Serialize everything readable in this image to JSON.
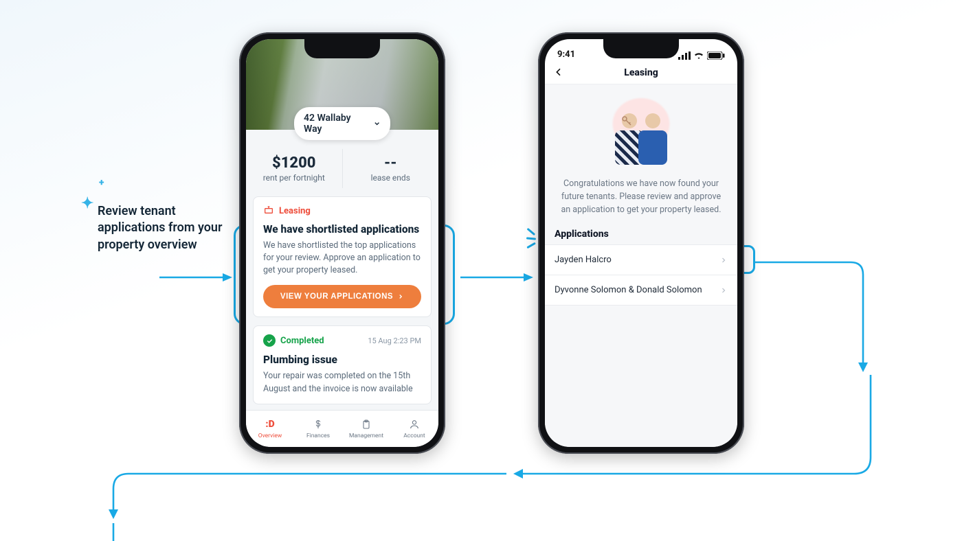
{
  "annotation": {
    "text": "Review tenant applications from your property overview"
  },
  "phone1": {
    "address": "42 Wallaby Way",
    "stats": {
      "rent_value": "$1200",
      "rent_label": "rent per fortnight",
      "lease_value": "--",
      "lease_label": "lease ends"
    },
    "card_leasing": {
      "tag": "Leasing",
      "title": "We have shortlisted applications",
      "body": "We have shortlisted the top applications for your review. Approve an application to get your property leased.",
      "cta": "VIEW YOUR APPLICATIONS"
    },
    "card_completed": {
      "tag": "Completed",
      "timestamp": "15 Aug 2:23 PM",
      "title": "Plumbing issue",
      "body": "Your repair was completed on the 15th August and the invoice is now available"
    },
    "tabbar": {
      "overview": "Overview",
      "finances": "Finances",
      "management": "Management",
      "account": "Account",
      "overview_glyph": ":D"
    }
  },
  "phone2": {
    "status_time": "9:41",
    "nav_title": "Leasing",
    "congrats": "Congratulations we have now found your future tenants. Please review and approve an application to get your property leased.",
    "applications_heading": "Applications",
    "applications": [
      {
        "name": "Jayden Halcro"
      },
      {
        "name": "Dyvonne Solomon & Donald Solomon"
      }
    ]
  },
  "colors": {
    "accent_blue": "#19a9e5",
    "brand_orange": "#ee7e3d",
    "brand_red": "#ee4d3b",
    "success": "#16a34a"
  }
}
